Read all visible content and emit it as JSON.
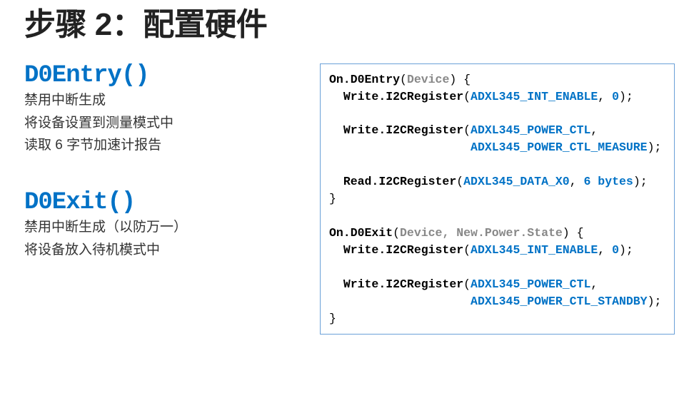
{
  "slide": {
    "title": "步骤 2：配置硬件",
    "left": {
      "entry": {
        "heading": "D0Entry()",
        "line1": "禁用中断生成",
        "line2": "将设备设置到测量模式中",
        "line3": "读取 6 字节加速计报告"
      },
      "exit": {
        "heading": "D0Exit()",
        "line1": "禁用中断生成（以防万一）",
        "line2": "将设备放入待机模式中"
      }
    },
    "code": {
      "entry": {
        "sig_fn": "On.D0Entry",
        "sig_param": "Device",
        "l1_call": "Write.I2CRegister",
        "l1_arg1": "ADXL345_INT_ENABLE",
        "l1_arg2": "0",
        "l2_call": "Write.I2CRegister",
        "l2_arg1": "ADXL345_POWER_CTL",
        "l2_arg2": "ADXL345_POWER_CTL_MEASURE",
        "l3_call": "Read.I2CRegister",
        "l3_arg1": "ADXL345_DATA_X0",
        "l3_arg2": "6 bytes"
      },
      "exit": {
        "sig_fn": "On.D0Exit",
        "sig_param": "Device, New.Power.State",
        "l1_call": "Write.I2CRegister",
        "l1_arg1": "ADXL345_INT_ENABLE",
        "l1_arg2": "0",
        "l2_call": "Write.I2CRegister",
        "l2_arg1": "ADXL345_POWER_CTL",
        "l2_arg2": "ADXL345_POWER_CTL_STANDBY"
      }
    }
  }
}
